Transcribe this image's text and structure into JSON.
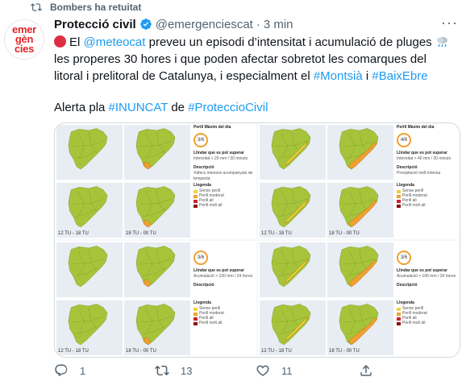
{
  "retweet": {
    "label": "Bombers ha retuitat"
  },
  "avatar": {
    "line1": "emer",
    "line2": "gèn",
    "line3": "cies"
  },
  "header": {
    "name": "Protecció civil",
    "handle": "@emergenciescat",
    "dot": "·",
    "time": "3 min"
  },
  "tweet": {
    "part1": "El ",
    "mention": "@meteocat",
    "part2": " preveu un episodi d’intensitat i acumulació de pluges ",
    "part3": "les properes 30 hores i que poden afectar sobretot les comarques del litoral i prelitoral de Catalunya, i especialment el ",
    "hashtag1": "#Montsià",
    "part4": " i ",
    "hashtag2": "#BaixEbre",
    "alert_prefix": "Alerta pla ",
    "hashtag3": "#INUNCAT",
    "alert_mid": " de ",
    "hashtag4": "#ProteccioCivil"
  },
  "media": {
    "panels": [
      {
        "time1": "12 TU - 18 TU",
        "time2": "18 TU - 00 TU",
        "title": "Perill Màxim del dia",
        "level": "3/6",
        "threshold": "Llindar que es pot superar",
        "detail": "Intensitat > 20 mm / 30 minuts",
        "desc_title": "Descripció",
        "desc": "Xàfecs intensos acompanyats de tempesta",
        "legend_title": "Llegenda",
        "legend": [
          "Sense perill",
          "Perill moderat",
          "Perill alt",
          "Perill molt alt"
        ]
      },
      {
        "time1": "12 TU - 18 TU",
        "time2": "18 TU - 00 TU",
        "title": "Perill Màxim del dia",
        "level": "4/6",
        "threshold": "Llindar que es pot superar",
        "detail": "Intensitat > 40 mm / 30 minuts",
        "desc_title": "Descripció",
        "desc": "Precipitació molt intensa",
        "legend_title": "Llegenda",
        "legend": [
          "Sense perill",
          "Perill moderat",
          "Perill alt",
          "Perill molt alt"
        ]
      },
      {
        "time1": "12 TU - 18 TU",
        "time2": "18 TU - 00 TU",
        "title": "",
        "level": "3/6",
        "threshold": "Llindar que es pot superar",
        "detail": "Acumulació > 100 mm / 24 hores",
        "desc_title": "Descripció",
        "desc": "",
        "legend_title": "Llegenda",
        "legend": [
          "Sense perill",
          "Perill moderat",
          "Perill alt",
          "Perill molt alt"
        ]
      },
      {
        "time1": "12 TU - 18 TU",
        "time2": "18 TU - 00 TU",
        "title": "",
        "level": "3/6",
        "threshold": "Llindar que es pot superar",
        "detail": "Acumulació > 100 mm / 24 hores",
        "desc_title": "Descripció",
        "desc": "",
        "legend_title": "Llegenda",
        "legend": [
          "Sense perill",
          "Perill moderat",
          "Perill alt",
          "Perill molt alt"
        ]
      }
    ],
    "colors": {
      "green": "#a6c43a",
      "yellow": "#f2d23a",
      "orange": "#f0a030",
      "red": "#d0202a"
    }
  },
  "actions": {
    "reply_count": "1",
    "retweet_count": "13",
    "like_count": "11"
  }
}
